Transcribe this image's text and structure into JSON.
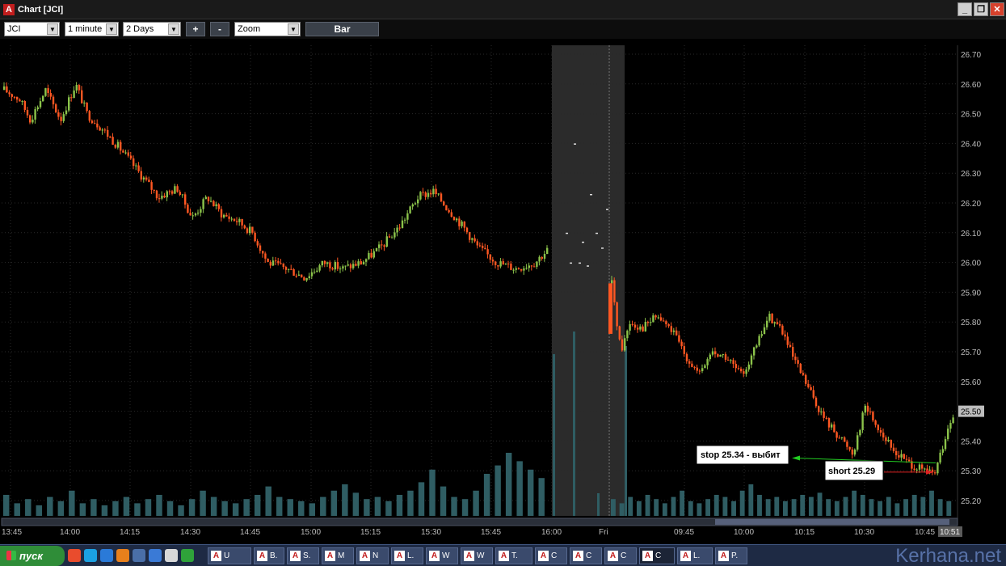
{
  "window": {
    "title": "Chart [JCI]",
    "app_icon": "A"
  },
  "toolbar": {
    "symbol": "JCI",
    "interval": "1 minute",
    "period": "2 Days",
    "zoom_in_label": "+",
    "zoom_out_label": "-",
    "zoom": "Zoom",
    "bar_label": "Bar"
  },
  "chart_data": {
    "type": "candlestick",
    "symbol": "JCI",
    "ylim": [
      25.16,
      26.72
    ],
    "y_ticks": [
      "26.70",
      "26.60",
      "26.50",
      "26.40",
      "26.30",
      "26.20",
      "26.10",
      "26.00",
      "25.90",
      "25.80",
      "25.70",
      "25.60",
      "25.50",
      "25.40",
      "25.30",
      "25.20"
    ],
    "x_ticks": [
      "13:45",
      "14:00",
      "14:15",
      "14:30",
      "14:45",
      "15:00",
      "15:15",
      "15:30",
      "15:45",
      "16:00",
      "Fri",
      "09:45",
      "10:00",
      "10:15",
      "10:30",
      "10:45"
    ],
    "current_price": "25.50",
    "current_time": "10:51",
    "closed_session": [
      "16:00",
      "Fri"
    ],
    "day1_close_path": [
      [
        0,
        26.58
      ],
      [
        8,
        26.55
      ],
      [
        14,
        26.48
      ],
      [
        22,
        26.58
      ],
      [
        30,
        26.48
      ],
      [
        38,
        26.6
      ],
      [
        44,
        26.5
      ],
      [
        52,
        26.45
      ],
      [
        62,
        26.38
      ],
      [
        72,
        26.3
      ],
      [
        82,
        26.22
      ],
      [
        92,
        26.25
      ],
      [
        100,
        26.15
      ],
      [
        108,
        26.22
      ],
      [
        116,
        26.16
      ],
      [
        124,
        26.14
      ],
      [
        132,
        26.1
      ],
      [
        140,
        26.0
      ],
      [
        150,
        25.98
      ],
      [
        160,
        25.95
      ],
      [
        170,
        26.0
      ],
      [
        180,
        25.98
      ],
      [
        190,
        26.0
      ],
      [
        200,
        26.05
      ],
      [
        210,
        26.12
      ],
      [
        220,
        26.22
      ],
      [
        228,
        26.24
      ],
      [
        236,
        26.18
      ],
      [
        244,
        26.12
      ],
      [
        252,
        26.05
      ],
      [
        262,
        26.0
      ],
      [
        272,
        25.98
      ],
      [
        282,
        26.0
      ],
      [
        290,
        26.05
      ]
    ],
    "day1_volume": [
      10,
      6,
      8,
      5,
      9,
      7,
      12,
      6,
      8,
      5,
      7,
      9,
      6,
      8,
      10,
      7,
      5,
      8,
      12,
      9,
      7,
      6,
      8,
      10,
      14,
      9,
      8,
      7,
      6,
      9,
      12,
      15,
      11,
      8,
      9,
      7,
      10,
      12,
      16,
      22,
      14,
      9,
      8,
      12,
      20,
      24,
      30,
      26,
      22,
      18
    ],
    "day2_close_path": [
      [
        0,
        25.93
      ],
      [
        6,
        25.7
      ],
      [
        12,
        25.8
      ],
      [
        20,
        25.78
      ],
      [
        30,
        25.82
      ],
      [
        40,
        25.77
      ],
      [
        50,
        25.68
      ],
      [
        58,
        25.62
      ],
      [
        66,
        25.7
      ],
      [
        76,
        25.68
      ],
      [
        86,
        25.62
      ],
      [
        96,
        25.72
      ],
      [
        104,
        25.82
      ],
      [
        112,
        25.78
      ],
      [
        120,
        25.68
      ],
      [
        130,
        25.58
      ],
      [
        140,
        25.48
      ],
      [
        150,
        25.42
      ],
      [
        160,
        25.36
      ],
      [
        168,
        25.52
      ],
      [
        176,
        25.45
      ],
      [
        186,
        25.37
      ],
      [
        196,
        25.33
      ],
      [
        206,
        25.3
      ],
      [
        214,
        25.29
      ],
      [
        222,
        25.42
      ],
      [
        228,
        25.5
      ]
    ],
    "day2_volume": [
      8,
      6,
      9,
      7,
      10,
      8,
      6,
      9,
      12,
      7,
      6,
      8,
      10,
      9,
      7,
      12,
      15,
      10,
      8,
      9,
      7,
      8,
      10,
      9,
      11,
      8,
      7,
      9,
      12,
      10,
      8,
      7,
      9,
      6,
      8,
      10,
      9,
      12,
      8,
      7
    ],
    "annotations": [
      {
        "text": "stop 25.34 - выбит",
        "price": 25.34,
        "line_color": "#22cc22"
      },
      {
        "text": "short 25.29",
        "price": 25.29,
        "line_color": "#dd2222"
      }
    ],
    "colors": {
      "up": "#8bc34a",
      "down": "#ff5722",
      "volume": "#2f5d63",
      "grid": "#2a2a2a",
      "closed_shade": "#2b2b2b",
      "price_marker": "#bdbdbd"
    }
  },
  "taskbar": {
    "start_label": "пуск",
    "items": [
      {
        "icon": "A",
        "label": "U"
      },
      {
        "icon": "A",
        "label": "B."
      },
      {
        "icon": "A",
        "label": "S."
      },
      {
        "icon": "A",
        "label": "M"
      },
      {
        "icon": "A",
        "label": "N"
      },
      {
        "icon": "A",
        "label": "L."
      },
      {
        "icon": "A",
        "label": "W"
      },
      {
        "icon": "A",
        "label": "W"
      },
      {
        "icon": "A",
        "label": "T."
      },
      {
        "icon": "A",
        "label": "C"
      },
      {
        "icon": "A",
        "label": "C"
      },
      {
        "icon": "A",
        "label": "C"
      },
      {
        "icon": "A",
        "label": "C"
      },
      {
        "icon": "A",
        "label": "L."
      },
      {
        "icon": "A",
        "label": "P."
      }
    ],
    "watermark": "Kerhana.net"
  }
}
